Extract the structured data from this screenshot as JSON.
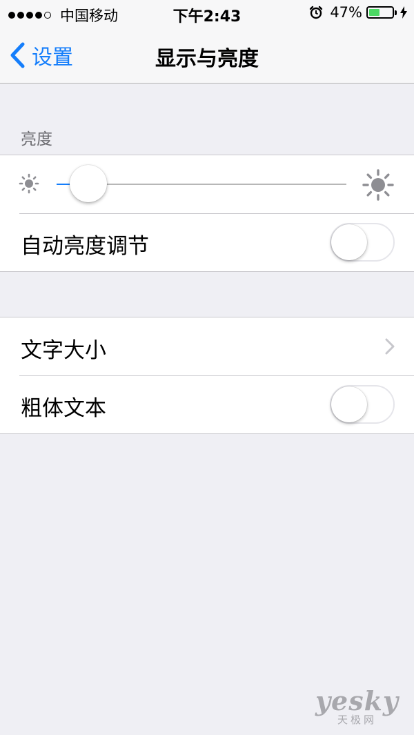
{
  "status_bar": {
    "carrier": "中国移动",
    "time": "下午2:43",
    "battery_percent": "47%",
    "battery_level": 0.47,
    "signal_bars_filled": 4,
    "signal_bars_total": 5,
    "icons": [
      "alarm-icon",
      "charging-bolt-icon"
    ],
    "battery_color": "#4cd964"
  },
  "nav": {
    "back_label": "设置",
    "title": "显示与亮度",
    "accent_color": "#157efb"
  },
  "brightness_section": {
    "header": "亮度",
    "slider_value": 0.11,
    "auto_brightness_label": "自动亮度调节",
    "auto_brightness_on": false
  },
  "text_section": {
    "text_size_label": "文字大小",
    "bold_text_label": "粗体文本",
    "bold_text_on": false
  },
  "watermark": {
    "main": "yesky",
    "sub": "天极网"
  }
}
